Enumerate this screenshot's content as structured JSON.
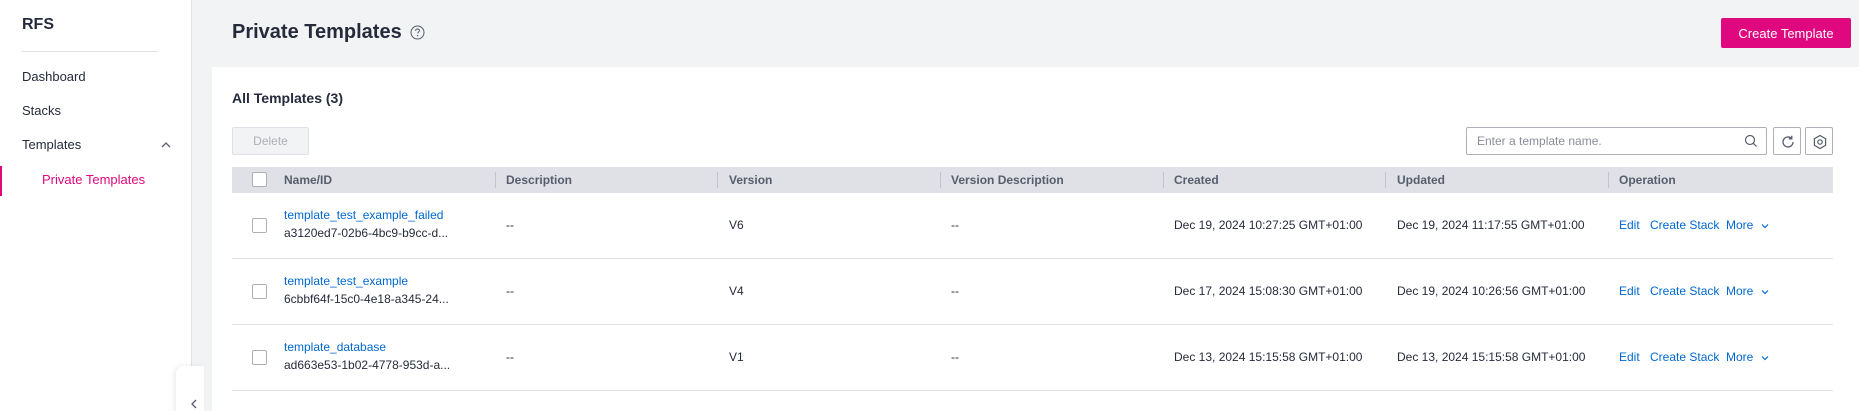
{
  "sidebar": {
    "brand": "RFS",
    "items": [
      {
        "label": "Dashboard"
      },
      {
        "label": "Stacks"
      },
      {
        "label": "Templates"
      }
    ],
    "subitems": [
      {
        "label": "Private Templates",
        "active": true
      }
    ]
  },
  "header": {
    "title": "Private Templates",
    "create_button": "Create Template"
  },
  "card": {
    "title": "All Templates (3)",
    "delete_button": "Delete",
    "search_placeholder": "Enter a template name."
  },
  "table": {
    "columns": [
      "Name/ID",
      "Description",
      "Version",
      "Version Description",
      "Created",
      "Updated",
      "Operation"
    ],
    "rows": [
      {
        "name": "template_test_example_failed",
        "id": "a3120ed7-02b6-4bc9-b9cc-d...",
        "description": "--",
        "version": "V6",
        "version_description": "--",
        "created": "Dec 19, 2024 10:27:25 GMT+01:00",
        "updated": "Dec 19, 2024 11:17:55 GMT+01:00"
      },
      {
        "name": "template_test_example",
        "id": "6cbbf64f-15c0-4e18-a345-24...",
        "description": "--",
        "version": "V4",
        "version_description": "--",
        "created": "Dec 17, 2024 15:08:30 GMT+01:00",
        "updated": "Dec 19, 2024 10:26:56 GMT+01:00"
      },
      {
        "name": "template_database",
        "id": "ad663e53-1b02-4778-953d-a...",
        "description": "--",
        "version": "V1",
        "version_description": "--",
        "created": "Dec 13, 2024 15:15:58 GMT+01:00",
        "updated": "Dec 13, 2024 15:15:58 GMT+01:00"
      }
    ],
    "operations": {
      "edit": "Edit",
      "create_stack": "Create Stack",
      "more": "More"
    }
  },
  "colors": {
    "accent": "#e0087e",
    "link": "#0067d1",
    "header_bg": "#dfe1e6"
  },
  "icons": [
    "help-icon",
    "search-icon",
    "refresh-icon",
    "settings-icon",
    "chevron-up-icon",
    "chevron-down-icon",
    "chevron-left-icon"
  ]
}
